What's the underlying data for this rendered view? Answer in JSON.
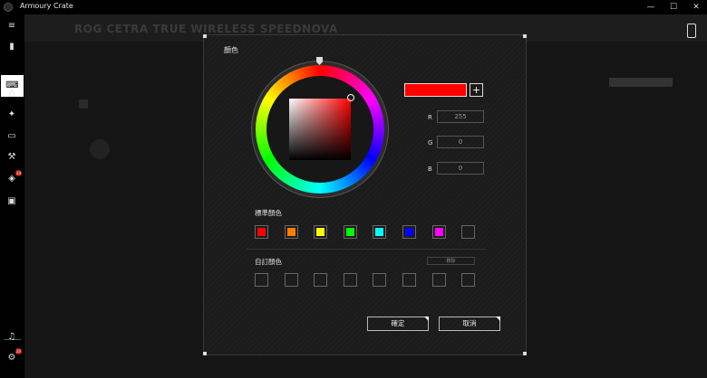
{
  "titlebar": {
    "title": "Armoury Crate",
    "minimize": "—",
    "maximize": "☐",
    "close": "✕"
  },
  "sidebar": {
    "icons": [
      "menu-icon",
      "device-icon",
      "devices-icon",
      "aura-icon",
      "armoury-icon",
      "gamevisual-icon",
      "tools-icon",
      "deals-icon",
      "news-icon",
      "notification-icon",
      "settings-icon"
    ],
    "badges": [
      "24",
      "24"
    ]
  },
  "background": {
    "device_title": "ROG CETRA TRUE WIRELESS SPEEDNOVA"
  },
  "dialog": {
    "title": "顏色",
    "current_color": "#ff0000",
    "add_label": "+",
    "r_label": "R",
    "g_label": "G",
    "b_label": "B",
    "r_value": "255",
    "g_value": "0",
    "b_value": "0",
    "standard_label": "標準顏色",
    "standard_colors": [
      "#ff0000",
      "#ff7f00",
      "#ffff00",
      "#00ff00",
      "#00ffff",
      "#0000ff",
      "#ff00ff",
      ""
    ],
    "custom_label": "自訂顏色",
    "delete_label": "刪除",
    "ok_label": "確定",
    "cancel_label": "取消"
  }
}
